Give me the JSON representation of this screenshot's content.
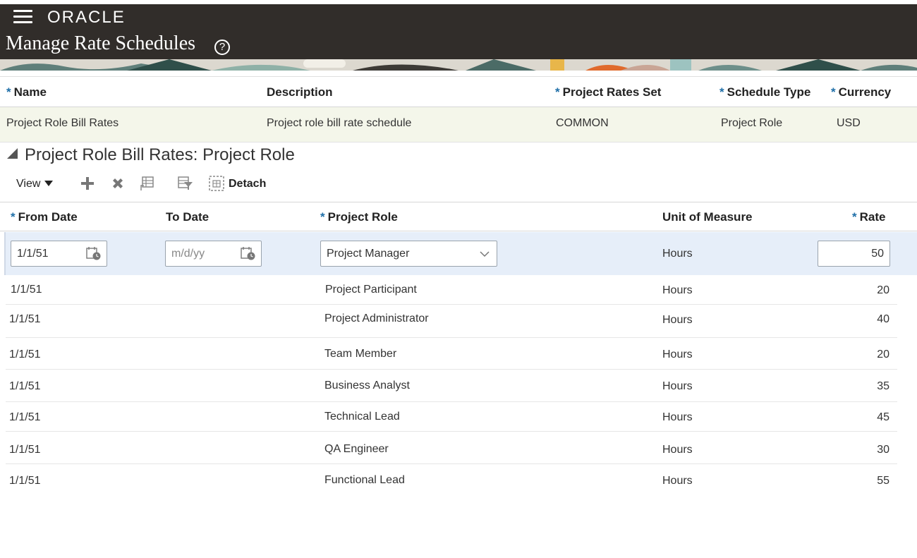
{
  "app": {
    "logo": "ORACLE",
    "page_title": "Manage Rate Schedules",
    "help_glyph": "?"
  },
  "header_table": {
    "columns": [
      {
        "label": "Name",
        "required": true
      },
      {
        "label": "Description",
        "required": false
      },
      {
        "label": "Project Rates Set",
        "required": true
      },
      {
        "label": "Schedule Type",
        "required": true
      },
      {
        "label": "Currency",
        "required": true
      }
    ],
    "row": {
      "name": "Project Role Bill Rates",
      "description": "Project role bill rate schedule",
      "rates_set": "COMMON",
      "schedule_type": "Project Role",
      "currency": "USD"
    }
  },
  "section": {
    "title": "Project Role Bill Rates: Project Role"
  },
  "toolbar": {
    "view_label": "View",
    "detach_label": "Detach"
  },
  "grid": {
    "columns": {
      "from_date": "From Date",
      "to_date": "To Date",
      "project_role": "Project Role",
      "unit_of_measure": "Unit of Measure",
      "rate": "Rate"
    },
    "required_marker": "*",
    "edit_row": {
      "from_date": "1/1/51",
      "to_date_placeholder": "m/d/yy",
      "project_role": "Project Manager",
      "unit_of_measure": "Hours",
      "rate": "50"
    },
    "rows": [
      {
        "from_date": "1/1/51",
        "to_date": "",
        "project_role": "Project Participant",
        "unit_of_measure": "Hours",
        "rate": "20"
      },
      {
        "from_date": "1/1/51",
        "to_date": "",
        "project_role": "Project Administrator",
        "unit_of_measure": "Hours",
        "rate": "40"
      },
      {
        "from_date": "1/1/51",
        "to_date": "",
        "project_role": "Team Member",
        "unit_of_measure": "Hours",
        "rate": "20"
      },
      {
        "from_date": "1/1/51",
        "to_date": "",
        "project_role": "Business Analyst",
        "unit_of_measure": "Hours",
        "rate": "35"
      },
      {
        "from_date": "1/1/51",
        "to_date": "",
        "project_role": "Technical Lead",
        "unit_of_measure": "Hours",
        "rate": "45"
      },
      {
        "from_date": "1/1/51",
        "to_date": "",
        "project_role": "QA Engineer",
        "unit_of_measure": "Hours",
        "rate": "30"
      },
      {
        "from_date": "1/1/51",
        "to_date": "",
        "project_role": "Functional Lead",
        "unit_of_measure": "Hours",
        "rate": "55"
      }
    ]
  },
  "colors": {
    "topbar": "#312d2a",
    "required": "#1f6fa8",
    "edit_row": "#e6eef9",
    "header_row": "#f4f6ea"
  }
}
